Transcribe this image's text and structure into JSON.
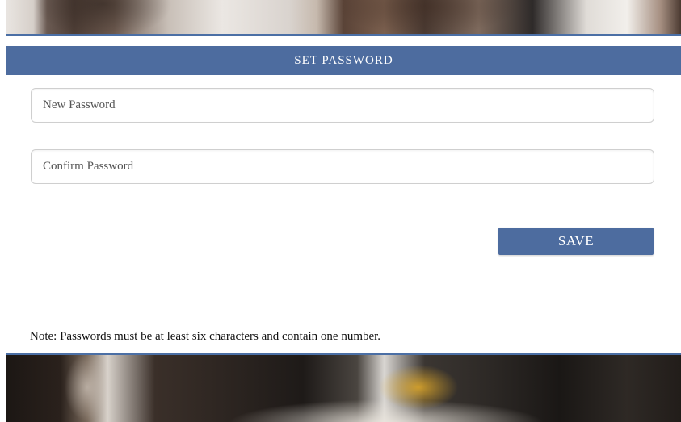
{
  "header": {
    "title": "SET PASSWORD"
  },
  "form": {
    "new_password": {
      "placeholder": "New Password",
      "value": ""
    },
    "confirm_password": {
      "placeholder": "Confirm Password",
      "value": ""
    },
    "save_label": "SAVE"
  },
  "note": "Note: Passwords must be at least six characters and contain one number.",
  "colors": {
    "accent": "#4d6c9f",
    "rule": "#4b6fa5"
  }
}
